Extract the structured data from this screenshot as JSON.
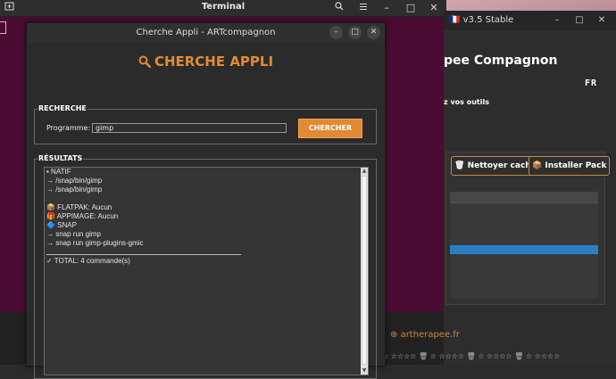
{
  "terminal": {
    "title": "Terminal",
    "search_icon": "search-icon",
    "menu_icon": "hamburger-menu-icon",
    "minimize": "–",
    "maximize": "□",
    "close": "✕"
  },
  "background_app": {
    "title": "🇫🇷 v3.5 Stable",
    "heading": "pee Compagnon",
    "lang_badge": "FR",
    "subtitle": "z vos outils",
    "buttons": [
      "Nettoyer cache",
      "Installer Pack"
    ],
    "website": "artherapee.fr",
    "status_row": "☆ ☆☆☆☆ 🗑  ☆ ☆☆☆☆ 🗑  ☆ ☆☆☆☆ 🗑  ☆ ☆☆☆☆"
  },
  "dialog": {
    "title": "Cherche Appli - ARTcompagnon",
    "heading": "CHERCHE APPLI",
    "minimize": "–",
    "maximize": "□",
    "close": "✕",
    "search_section": {
      "legend": "RECHERCHE",
      "program_label": "Programme:",
      "program_value": "gimp",
      "button_label": "CHERCHER"
    },
    "results_section": {
      "legend": "RÉSULTATS",
      "lines": [
        "▪ NATIF",
        "→ /snap/bin/gimp",
        "→ /snap/bin/gimp",
        "",
        "📦 FLATPAK: Aucun",
        "🎁 APPIMAGE: Aucun",
        "🔷 SNAP",
        "→ snap run gimp",
        "→ snap run gimp-plugins-gmic",
        "",
        "✓ TOTAL: 4 commande(s)"
      ]
    }
  },
  "colors": {
    "accent": "#e38a33",
    "terminal_bg": "#4b0c33",
    "dialog_bg": "#2b2b2b",
    "selection": "#2a7fc4"
  }
}
